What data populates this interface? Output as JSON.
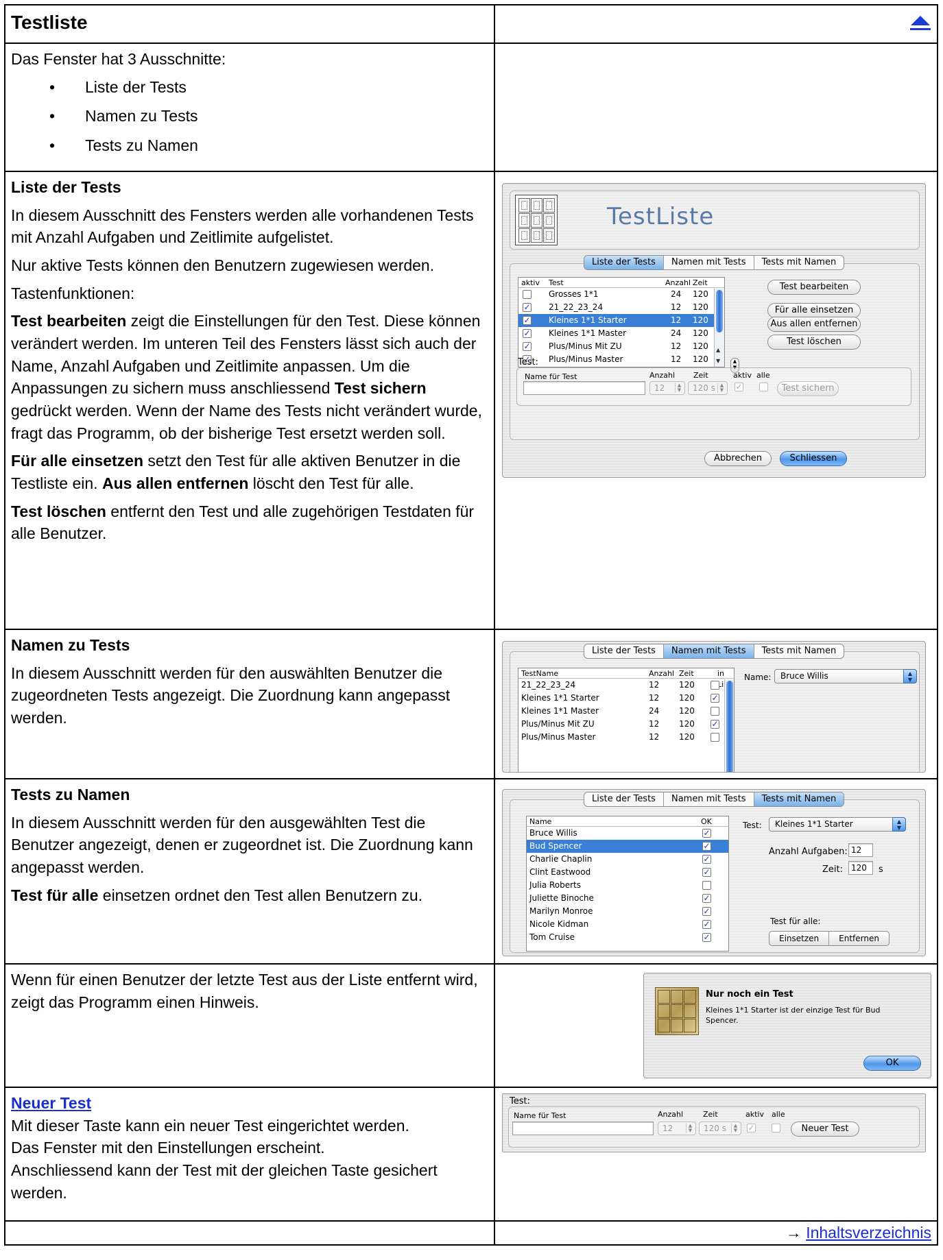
{
  "header": {
    "title": "Testliste",
    "up_icon": "arrow-up-icon"
  },
  "intro": {
    "text": "Das Fenster hat 3 Ausschnitte:",
    "bullets": [
      "Liste der Tests",
      "Namen zu Tests",
      "Tests zu Namen"
    ]
  },
  "section_list": {
    "heading": "Liste der Tests",
    "p1": "In diesem Ausschnitt des Fensters werden alle vorhandenen Tests mit Anzahl Aufgaben und Zeitlimite aufgelistet.",
    "p2": "Nur aktive Tests können den Benutzern zugewiesen werden.",
    "p3": "Tastenfunktionen:",
    "p4_bold": "Test bearbeiten",
    "p4_text": " zeigt die Einstellungen für den Test. Diese können verändert werden. Im unteren Teil des Fensters lässt sich auch der Name, Anzahl Aufgaben und Zeitlimite anpassen. Um die Anpassungen zu sichern muss anschliessend ",
    "p4_bold2": "Test sichern",
    "p4_text2": " gedrückt werden. Wenn der Name des Tests nicht verändert wurde, fragt das Programm, ob der bisherige Test ersetzt werden soll.",
    "p5_bold": "Für alle einsetzen",
    "p5_text": " setzt den Test für alle aktiven Benutzer in die Testliste ein. ",
    "p5_bold2": "Aus allen entfernen",
    "p5_text2": " löscht den Test für alle.",
    "p6_bold": "Test löschen",
    "p6_text": " entfernt den Test und alle zugehörigen Testdaten für alle Benutzer."
  },
  "section_names": {
    "heading": "Namen zu Tests",
    "p1": "In diesem Ausschnitt werden für den auswählten Benutzer die zugeordneten Tests angezeigt. Die Zuordnung kann angepasst werden."
  },
  "section_tests": {
    "heading": "Tests zu Namen",
    "p1": "In diesem Ausschnitt werden für den ausgewählten Test die Benutzer angezeigt, denen er zugeordnet ist. Die Zuordnung kann angepasst werden.",
    "p2_bold": "Test für alle",
    "p2_text": " einsetzen ordnet den Test allen Benutzern zu."
  },
  "section_hint": {
    "p1": "Wenn für einen Benutzer der letzte Test aus der Liste entfernt wird, zeigt das Programm einen Hinweis."
  },
  "section_new": {
    "link": "Neuer Test",
    "p1": " Mit dieser Taste kann ein neuer Test eingerichtet werden.",
    "p2": "Das Fenster mit den Einstellungen erscheint.",
    "p3": "Anschliessend kann der Test mit der gleichen Taste gesichert werden."
  },
  "footer": {
    "arrow": "→ ",
    "link_first": "I",
    "link_rest": "nhaltsverzeichnis"
  },
  "tabs": [
    "Liste der Tests",
    "Namen mit Tests",
    "Tests mit Namen"
  ],
  "ui_list": {
    "window_title": "TestListe",
    "columns": [
      "aktiv",
      "Test",
      "Anzahl",
      "Zeit"
    ],
    "rows": [
      {
        "name": "Grosses 1*1",
        "anzahl": "24",
        "zeit": "120",
        "aktiv": false,
        "selected": false
      },
      {
        "name": "21_22_23_24",
        "anzahl": "12",
        "zeit": "120",
        "aktiv": true,
        "selected": false
      },
      {
        "name": "Kleines 1*1 Starter",
        "anzahl": "12",
        "zeit": "120",
        "aktiv": true,
        "selected": true
      },
      {
        "name": "Kleines 1*1 Master",
        "anzahl": "24",
        "zeit": "120",
        "aktiv": true,
        "selected": false
      },
      {
        "name": "Plus/Minus Mit ZU",
        "anzahl": "12",
        "zeit": "120",
        "aktiv": true,
        "selected": false
      },
      {
        "name": "Plus/Minus Master",
        "anzahl": "12",
        "zeit": "120",
        "aktiv": true,
        "selected": false
      }
    ],
    "buttons": [
      "Test bearbeiten",
      "Für alle einsetzen",
      "Aus allen entfernen",
      "Test löschen"
    ],
    "test_group_label": "Test:",
    "field_labels": [
      "Name für Test",
      "Anzahl",
      "Zeit",
      "aktiv",
      "alle"
    ],
    "anzahl_value": "12",
    "zeit_value": "120 s",
    "save_button": "Test sichern",
    "cancel_button": "Abbrechen",
    "close_button": "Schliessen"
  },
  "ui_names": {
    "columns": [
      "TestName",
      "Anzahl",
      "Zeit",
      "in List"
    ],
    "rows": [
      {
        "name": "21_22_23_24",
        "anzahl": "12",
        "zeit": "120",
        "in_list": false
      },
      {
        "name": "Kleines 1*1 Starter",
        "anzahl": "12",
        "zeit": "120",
        "in_list": true
      },
      {
        "name": "Kleines 1*1 Master",
        "anzahl": "24",
        "zeit": "120",
        "in_list": false
      },
      {
        "name": "Plus/Minus Mit ZU",
        "anzahl": "12",
        "zeit": "120",
        "in_list": true
      },
      {
        "name": "Plus/Minus Master",
        "anzahl": "12",
        "zeit": "120",
        "in_list": false
      }
    ],
    "name_label": "Name:",
    "name_value": "Bruce Willis"
  },
  "ui_tests": {
    "columns": [
      "Name",
      "OK"
    ],
    "rows": [
      {
        "name": "Bruce Willis",
        "ok": true,
        "selected": false
      },
      {
        "name": "Bud Spencer",
        "ok": true,
        "selected": true
      },
      {
        "name": "Charlie Chaplin",
        "ok": true,
        "selected": false
      },
      {
        "name": "Clint Eastwood",
        "ok": true,
        "selected": false
      },
      {
        "name": "Julia Roberts",
        "ok": false,
        "selected": false
      },
      {
        "name": "Juliette Binoche",
        "ok": true,
        "selected": false
      },
      {
        "name": "Marilyn Monroe",
        "ok": true,
        "selected": false
      },
      {
        "name": "Nicole Kidman",
        "ok": true,
        "selected": false
      },
      {
        "name": "Tom Cruise",
        "ok": true,
        "selected": false
      }
    ],
    "test_label": "Test:",
    "test_value": "Kleines 1*1 Starter",
    "anzahl_label": "Anzahl Aufgaben:",
    "anzahl_value": "12",
    "zeit_label": "Zeit:",
    "zeit_value": "120",
    "zeit_unit": "s",
    "fuer_alle_label": "Test für alle:",
    "einsetzen": "Einsetzen",
    "entfernen": "Entfernen"
  },
  "ui_alert": {
    "title": "Nur noch ein Test",
    "message": "Kleines 1*1 Starter ist der einzige Test für Bud Spencer.",
    "ok": "OK"
  },
  "ui_new": {
    "group_label": "Test:",
    "field_labels": [
      "Name für Test",
      "Anzahl",
      "Zeit",
      "aktiv",
      "alle"
    ],
    "anzahl_value": "12",
    "zeit_value": "120 s",
    "button": "Neuer Test"
  }
}
